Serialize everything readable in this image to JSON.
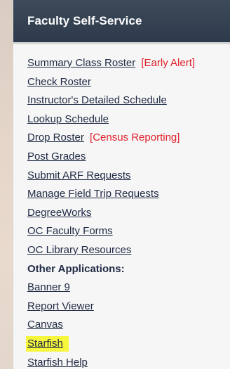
{
  "panel": {
    "title": "Faculty Self-Service"
  },
  "links": [
    {
      "label": "Summary Class Roster",
      "tag": "[Early Alert]"
    },
    {
      "label": "Check Roster"
    },
    {
      "label": "Instructor's Detailed Schedule"
    },
    {
      "label": "Lookup Schedule"
    },
    {
      "label": "Drop Roster",
      "tag": "[Census Reporting]"
    },
    {
      "label": "Post Grades"
    },
    {
      "label": "Submit ARF Requests"
    },
    {
      "label": "Manage Field Trip Requests"
    },
    {
      "label": "DegreeWorks"
    },
    {
      "label": "OC Faculty Forms"
    },
    {
      "label": "OC Library Resources"
    }
  ],
  "other_applications": {
    "heading": "Other Applications:",
    "links": [
      {
        "label": "Banner 9"
      },
      {
        "label": "Report Viewer"
      },
      {
        "label": "Canvas"
      },
      {
        "label": "Starfish"
      },
      {
        "label": "Starfish Help"
      }
    ]
  },
  "colors": {
    "header_bg": "#34404f",
    "link_text": "#1f2a44",
    "tag_text": "#e0202a",
    "highlight": "#f6f63c"
  }
}
